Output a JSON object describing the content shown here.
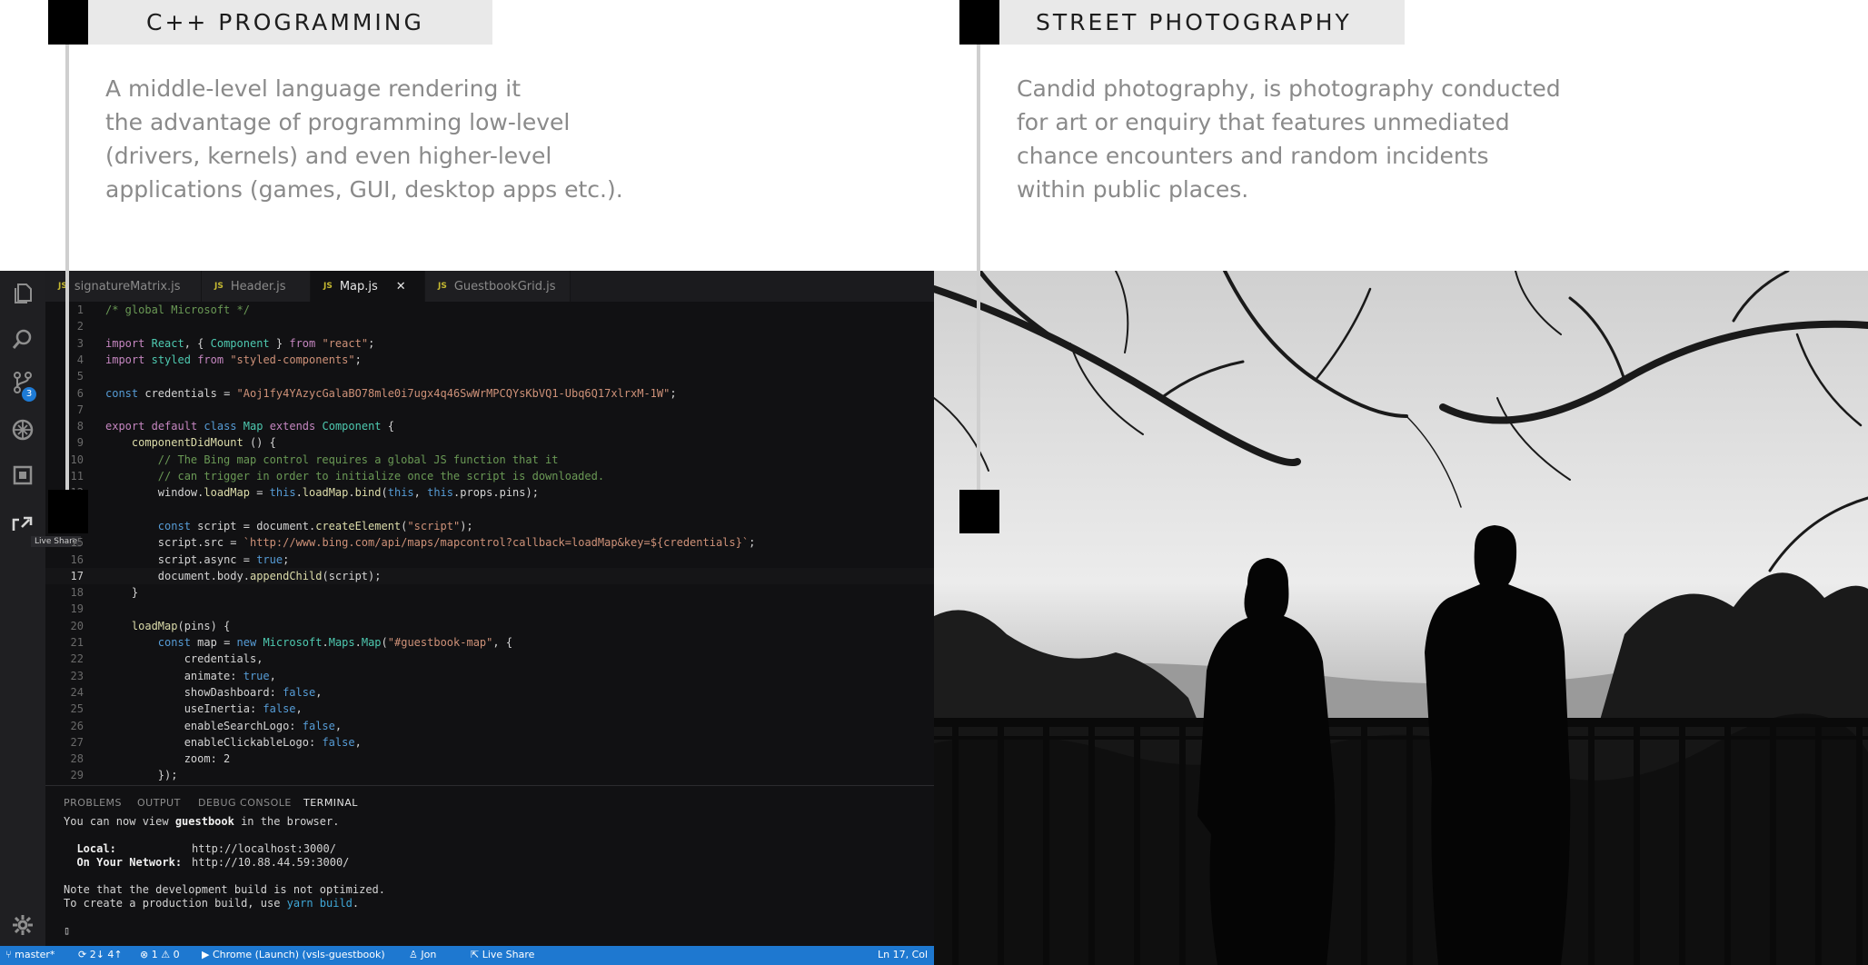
{
  "left_caption": {
    "title": "C++ PROGRAMMING",
    "lines": [
      "A middle-level language rendering it",
      "the advantage of programming low-level",
      "(drivers, kernels) and even higher-level",
      "applications (games, GUI, desktop apps etc.)."
    ]
  },
  "right_caption": {
    "title": "STREET PHOTOGRAPHY",
    "lines": [
      "Candid photography, is photography conducted",
      "for art or enquiry that features unmediated",
      "chance encounters and random incidents",
      "within public places."
    ]
  },
  "editor": {
    "activity_bar": {
      "icons": [
        "files-icon",
        "search-icon",
        "source-control-icon",
        "debug-icon",
        "extensions-icon",
        "live-share-icon",
        "gear-icon"
      ],
      "source_control_badge": "3",
      "tooltip": "Live Share"
    },
    "tabs": [
      {
        "label": "signatureMatrix.js",
        "active": false
      },
      {
        "label": "Header.js",
        "active": false
      },
      {
        "label": "Map.js",
        "active": true
      },
      {
        "label": "GuestbookGrid.js",
        "active": false
      }
    ],
    "tab_badge": "JS",
    "close_glyph": "✕",
    "current_line": 17,
    "code_lines": [
      "/* global Microsoft */",
      "",
      "import React, { Component } from \"react\";",
      "import styled from \"styled-components\";",
      "",
      "const credentials = \"Aoj1fy4YAzycGalaBO78mle0i7ugx4q46SwWrMPCQYsKbVQ1-Ubq6Q17xlrxM-1W\";",
      "",
      "export default class Map extends Component {",
      "    componentDidMount () {",
      "        // The Bing map control requires a global JS function that it",
      "        // can trigger in order to initialize once the script is downloaded.",
      "        window.loadMap = this.loadMap.bind(this, this.props.pins);",
      "",
      "        const script = document.createElement(\"script\");",
      "        script.src = `http://www.bing.com/api/maps/mapcontrol?callback=loadMap&key=${credentials}`;",
      "        script.async = true;",
      "        document.body.appendChild(script);",
      "    }",
      "",
      "    loadMap(pins) {",
      "        const map = new Microsoft.Maps.Map(\"#guestbook-map\", {",
      "            credentials,",
      "            animate: true,",
      "            showDashboard: false,",
      "            useInertia: false,",
      "            enableSearchLogo: false,",
      "            enableClickableLogo: false,",
      "            zoom: 2",
      "        });"
    ],
    "panel": {
      "tabs": [
        "PROBLEMS",
        "OUTPUT",
        "DEBUG CONSOLE",
        "TERMINAL"
      ],
      "active_tab": "TERMINAL",
      "terminal": {
        "line1_pre": "You can now view ",
        "line1_bold": "guestbook",
        "line1_post": " in the browser.",
        "local_label": "  Local:",
        "local_url": "http://localhost:3000/",
        "network_label": "  On Your Network:",
        "network_url": "http://10.88.44.59:3000/",
        "note1": "Note that the development build is not optimized.",
        "note2_pre": "To create a production build, use ",
        "note2_link": "yarn build",
        "note2_post": ".",
        "cursor": "▯"
      }
    },
    "status_bar": {
      "branch": "master*",
      "sync": "2↓ 4↑",
      "problems": "1 ⚠ 0",
      "debug": "Chrome (Launch) (vsls-guestbook)",
      "user": "Jon",
      "live_share": "Live Share",
      "position": "Ln 17, Col"
    }
  },
  "photo": {
    "subject": "silhouette-couple-at-railing"
  }
}
